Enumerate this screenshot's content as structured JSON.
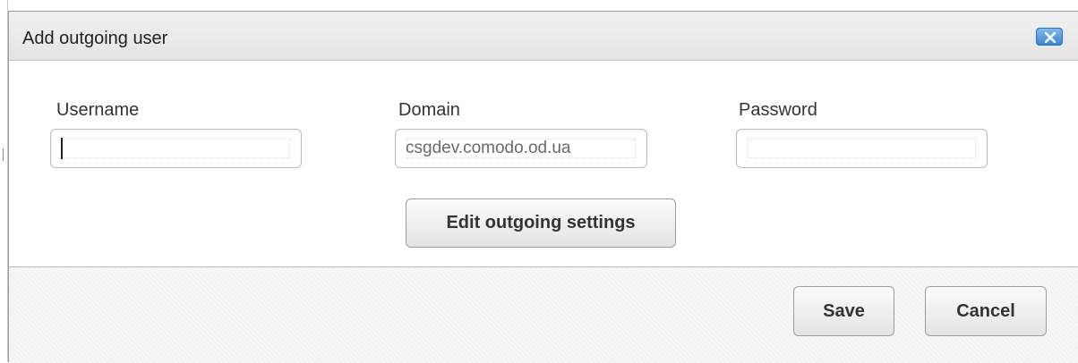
{
  "dialog": {
    "title": "Add outgoing user",
    "close_icon": "close-x-icon"
  },
  "form": {
    "username_label": "Username",
    "username_value": "",
    "domain_label": "Domain",
    "domain_value": "csgdev.comodo.od.ua",
    "password_label": "Password",
    "password_value": "",
    "edit_settings_label": "Edit outgoing settings"
  },
  "footer": {
    "save_label": "Save",
    "cancel_label": "Cancel"
  },
  "colors": {
    "close_button": "#3a86d4",
    "title_bar": "#e8e8e8"
  }
}
